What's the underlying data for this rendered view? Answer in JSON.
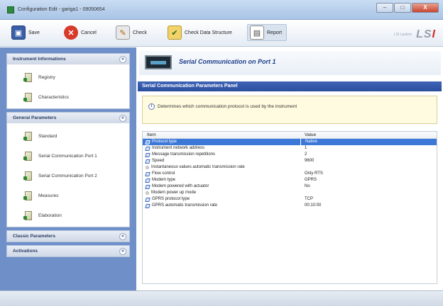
{
  "window": {
    "title": "Configuration Edit - gariga1 - 09050654",
    "controls": {
      "minimize": "–",
      "maximize": "□",
      "close": "X"
    }
  },
  "toolbar": {
    "save": {
      "label": "Save",
      "icon": "floppy-disk-icon"
    },
    "cancel": {
      "label": "Cancel",
      "icon": "cancel-icon"
    },
    "check": {
      "label": "Check",
      "icon": "check-icon"
    },
    "check_ds": {
      "label": "Check Data Structure",
      "icon": "check-data-structure-icon"
    },
    "report": {
      "label": "Report",
      "icon": "report-icon"
    },
    "brand_small": "LSI Lastem",
    "brand_logo_prefix": "LS",
    "brand_logo_suffix": "I"
  },
  "sidebar": {
    "groups": [
      {
        "title": "Instrument Informations",
        "items": [
          "Registry",
          "Characteristics"
        ]
      },
      {
        "title": "General Parameters",
        "items": [
          "Standard",
          "Serial Communication Port 1",
          "Serial Communication Port 2",
          "Measures",
          "Elaboration"
        ]
      },
      {
        "title": "Classic Parameters",
        "items": []
      },
      {
        "title": "Activations",
        "items": []
      }
    ],
    "collapse_glyph": "«"
  },
  "main": {
    "port_title": "Serial Communication on Port 1",
    "panel_title": "Serial Communication Parameters Panel",
    "info_text": "Determines which communication protocol is used by the instrument",
    "grid": {
      "col_item": "Item",
      "col_value": "Value",
      "rows": [
        {
          "item": "Protocol type",
          "value": "Native",
          "icon": "pen",
          "selected": true
        },
        {
          "item": "Instrument network address",
          "value": "1",
          "icon": "pen",
          "selected": false
        },
        {
          "item": "Message transmission repetitions",
          "value": "2",
          "icon": "pen",
          "selected": false
        },
        {
          "item": "Speed",
          "value": "9600",
          "icon": "pen",
          "selected": false
        },
        {
          "item": "Instantaneous values automatic transmission rate",
          "value": "",
          "icon": "gray",
          "selected": false
        },
        {
          "item": "Flow control",
          "value": "Only RTS",
          "icon": "pen",
          "selected": false
        },
        {
          "item": "Modem type",
          "value": "GPRS",
          "icon": "pen",
          "selected": false
        },
        {
          "item": "Modem powered with actuator",
          "value": "No",
          "icon": "pen",
          "selected": false
        },
        {
          "item": "Modem power up mode",
          "value": "",
          "icon": "gray",
          "selected": false
        },
        {
          "item": "GPRS protocol type",
          "value": "TCP",
          "icon": "pen",
          "selected": false
        },
        {
          "item": "GPRS automatic transmission rate",
          "value": "00:10:00",
          "icon": "pen",
          "selected": false
        }
      ]
    }
  }
}
